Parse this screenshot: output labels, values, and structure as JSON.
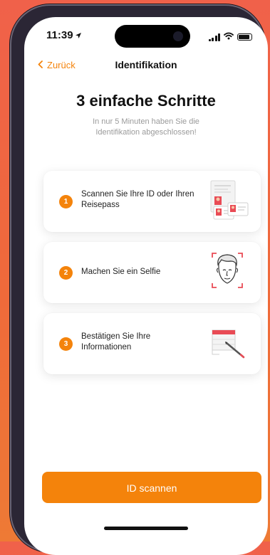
{
  "status_bar": {
    "time": "11:39"
  },
  "nav": {
    "back_label": "Zurück",
    "title": "Identifikation"
  },
  "header": {
    "headline": "3 einfache Schritte",
    "subtitle": "In nur 5 Minuten haben Sie die Identifikation abgeschlossen!"
  },
  "steps": [
    {
      "number": "1",
      "label": "Scannen Sie Ihre ID oder Ihren Reisepass",
      "icon": "id-document-icon"
    },
    {
      "number": "2",
      "label": "Machen Sie ein Selfie",
      "icon": "selfie-face-icon"
    },
    {
      "number": "3",
      "label": "Bestätigen Sie Ihre Informationen",
      "icon": "confirm-form-icon"
    }
  ],
  "cta": {
    "label": "ID scannen"
  },
  "colors": {
    "accent": "#f4830b",
    "background_gradient_top": "#f0614a",
    "frame": "#2b2635"
  }
}
